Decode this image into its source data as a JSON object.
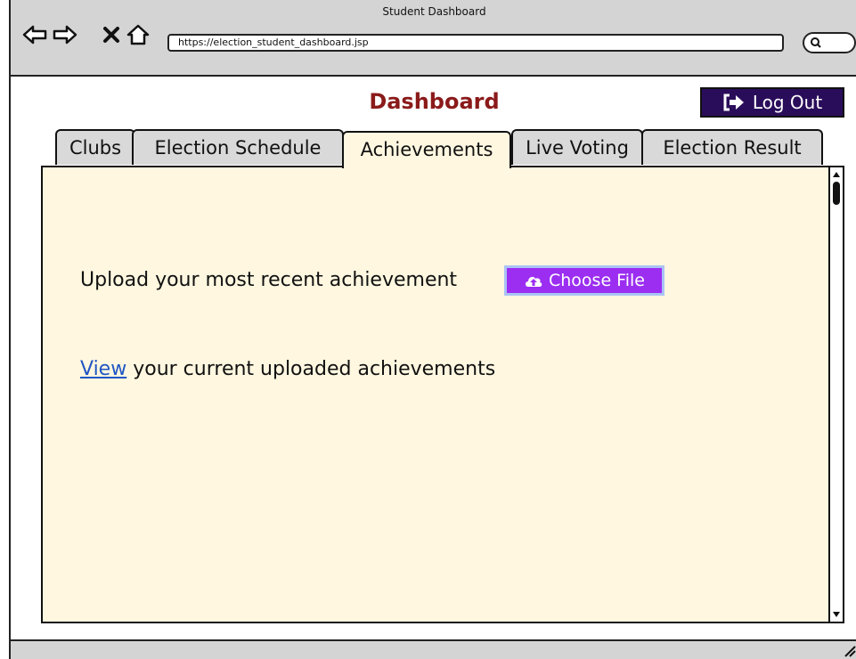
{
  "window": {
    "title": "Student Dashboard",
    "url": "https://election_student_dashboard.jsp"
  },
  "header": {
    "title": "Dashboard",
    "logout_label": "Log Out"
  },
  "tabs": [
    {
      "label": "Clubs",
      "active": false
    },
    {
      "label": "Election Schedule",
      "active": false
    },
    {
      "label": "Achievements",
      "active": true
    },
    {
      "label": "Live Voting",
      "active": false
    },
    {
      "label": "Election Result",
      "active": false
    }
  ],
  "content": {
    "upload_label": "Upload your most recent achievement",
    "choose_file_label": "Choose File",
    "view_link": "View",
    "view_rest": "your current uploaded achievements"
  },
  "colors": {
    "title": "#8b1a1a",
    "logout_bg": "#2a0d5a",
    "choose_bg": "#9b2ef0",
    "panel_bg": "#fff7e0",
    "link": "#1f56c4"
  },
  "icons": {
    "back": "back-arrow-icon",
    "forward": "forward-arrow-icon",
    "stop": "close-icon",
    "home": "home-icon",
    "search": "search-icon",
    "logout": "logout-icon",
    "upload": "cloud-upload-icon"
  }
}
